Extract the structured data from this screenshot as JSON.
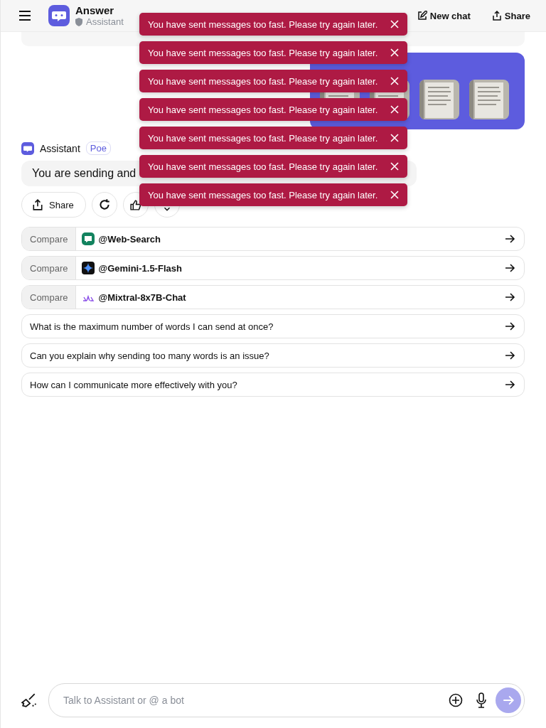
{
  "header": {
    "title": "Answer",
    "subtitle": "Assistant",
    "actions": [
      {
        "kind": "new",
        "label": "New chat"
      },
      {
        "kind": "share",
        "label": "Share"
      }
    ]
  },
  "user_message": {
    "images": [
      {
        "kind": "picture"
      },
      {
        "kind": "picture"
      },
      {
        "kind": "picture"
      },
      {
        "kind": "picture"
      }
    ]
  },
  "bot": {
    "name": "Assistant",
    "badge": "Poe",
    "message": "You are sending and"
  },
  "message_actions": [
    {
      "kind": "share",
      "label": "Share"
    },
    {
      "kind": "retry"
    },
    {
      "kind": "like"
    },
    {
      "kind": "more"
    }
  ],
  "compare": [
    {
      "label": "Compare",
      "bot": "@Web-Search",
      "kind": "web"
    },
    {
      "label": "Compare",
      "bot": "@Gemini-1.5-Flash",
      "kind": "gemini"
    },
    {
      "label": "Compare",
      "bot": "@Mixtral-8x7B-Chat",
      "kind": "mixtral"
    }
  ],
  "suggestions": [
    "What is the maximum number of words I can send at once?",
    "Can you explain why sending too many words is an issue?",
    "How can I communicate more effectively with you?"
  ],
  "composer": {
    "placeholder": "Talk to Assistant or @ a bot"
  },
  "toasts": [
    "You have sent messages too fast. Please try again later.",
    "You have sent messages too fast. Please try again later.",
    "You have sent messages too fast. Please try again later.",
    "You have sent messages too fast. Please try again later.",
    "You have sent messages too fast. Please try again later.",
    "You have sent messages too fast. Please try again later.",
    "You have sent messages too fast. Please try again later."
  ]
}
